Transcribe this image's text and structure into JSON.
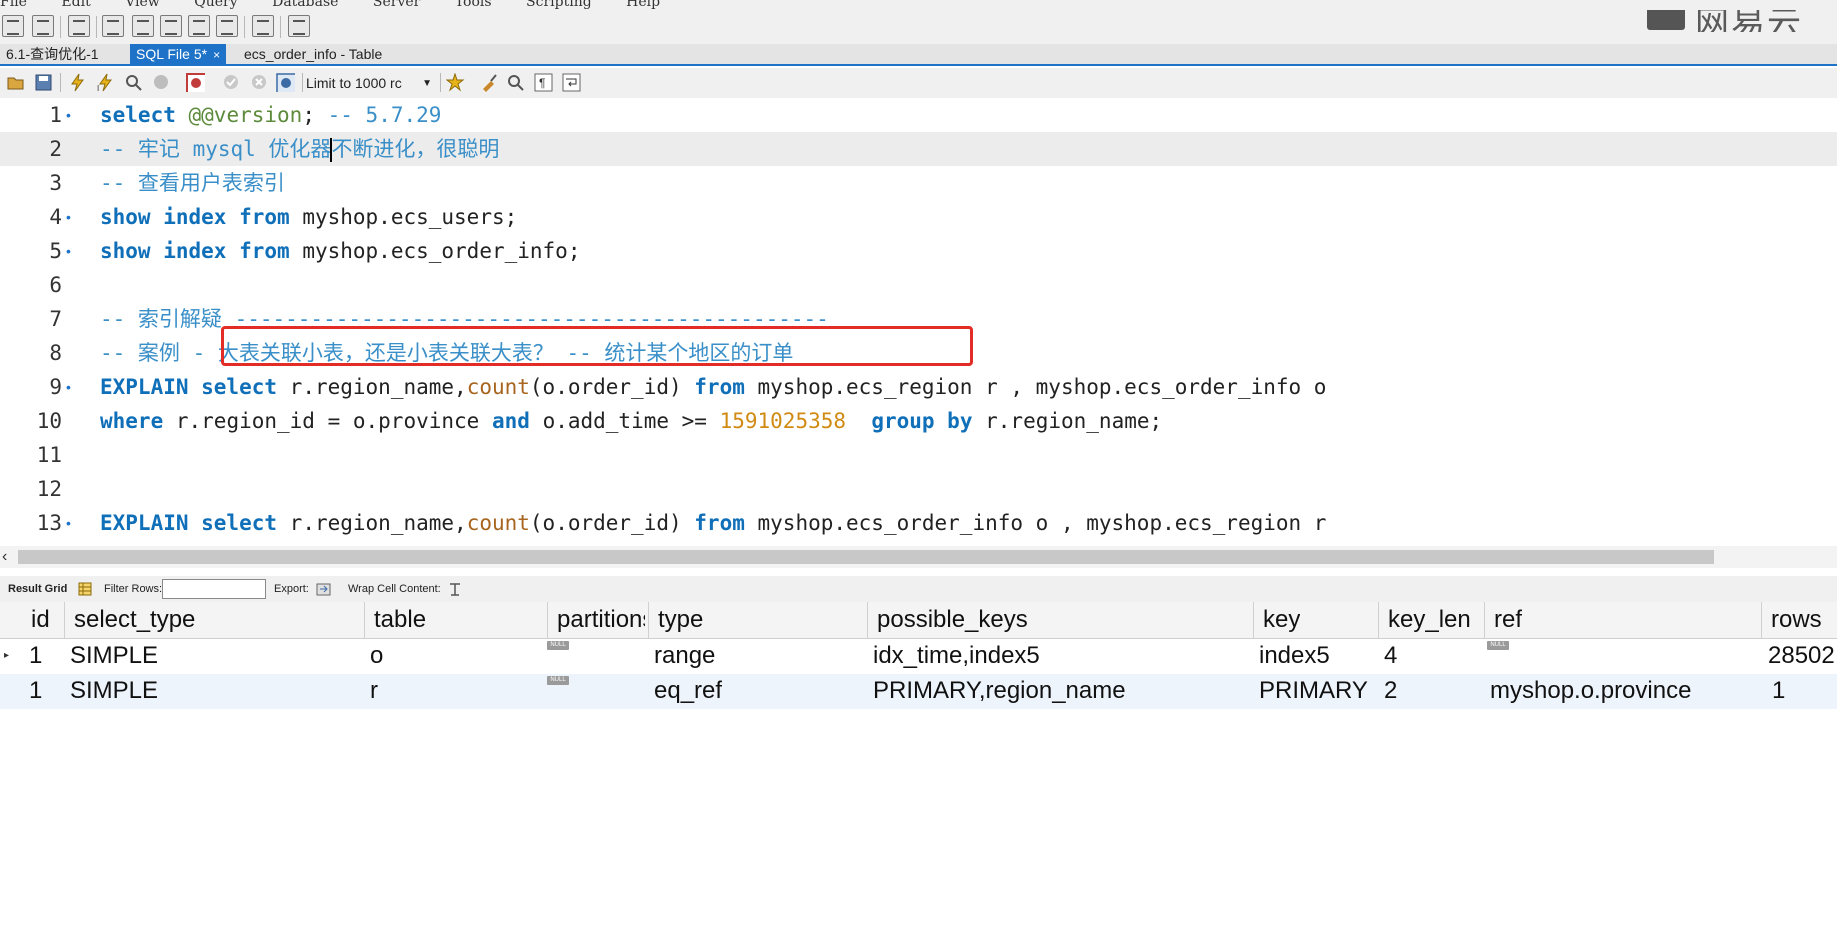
{
  "menu": [
    "File",
    "Edit",
    "View",
    "Query",
    "Database",
    "Server",
    "Tools",
    "Scripting",
    "Help"
  ],
  "logo_text": "网易云",
  "tabs": [
    {
      "label": "6.1-查询优化-1",
      "active": false
    },
    {
      "label": "SQL File 5*",
      "active": true,
      "close": "×"
    },
    {
      "label": "ecs_order_info - Table",
      "active": false
    }
  ],
  "toolbar2": {
    "limit_label": "Limit to 1000 rc"
  },
  "editor": {
    "lines": [
      {
        "n": "1",
        "marker": "•"
      },
      {
        "n": "2",
        "marker": ""
      },
      {
        "n": "3",
        "marker": ""
      },
      {
        "n": "4",
        "marker": "•"
      },
      {
        "n": "5",
        "marker": "•"
      },
      {
        "n": "6",
        "marker": ""
      },
      {
        "n": "7",
        "marker": ""
      },
      {
        "n": "8",
        "marker": ""
      },
      {
        "n": "9",
        "marker": "•"
      },
      {
        "n": "10",
        "marker": ""
      },
      {
        "n": "11",
        "marker": ""
      },
      {
        "n": "12",
        "marker": ""
      },
      {
        "n": "13",
        "marker": "•"
      }
    ],
    "l1": {
      "kw": "select",
      "var": "@@version",
      "rest": ";",
      "comment": "-- 5.7.29"
    },
    "l2": {
      "comment_a": "-- 牢记 mysql 优化器",
      "comment_b": "不断进化，很聪明"
    },
    "l3": {
      "comment": "-- 查看用户表索引"
    },
    "l4": {
      "kw": "show index from",
      "rest": "myshop.ecs_users;"
    },
    "l5": {
      "kw": "show index from",
      "rest": "myshop.ecs_order_info;"
    },
    "l7": {
      "comment": "-- 索引解疑 -----------------------------------------------"
    },
    "l8": {
      "comment": "-- 案例 - 大表关联小表，还是小表关联大表？ -- 统计某个地区的订单"
    },
    "l9": {
      "kw1": "EXPLAIN select",
      "t1": "r.region_name,",
      "fn": "count",
      "t2": "(o.order_id)",
      "kw2": "from",
      "t3": "myshop.ecs_region r , myshop.ecs_order_info o"
    },
    "l10": {
      "kw1": "where",
      "t1": "r.region_id = o.province",
      "kw2": "and",
      "t2": "o.add_time >=",
      "num": "1591025358",
      "kw3": "group by",
      "t3": "r.region_name;"
    },
    "l13": {
      "kw1": "EXPLAIN select",
      "t1": "r.region_name,",
      "fn": "count",
      "t2": "(o.order_id)",
      "kw2": "from",
      "t3": "myshop.ecs_order_info o , myshop.ecs_region r"
    }
  },
  "resultbar": {
    "result_grid": "Result Grid",
    "filter_rows": "Filter Rows:",
    "export": "Export:",
    "wrap": "Wrap Cell Content:"
  },
  "grid": {
    "columns": [
      "id",
      "select_type",
      "table",
      "partitions",
      "type",
      "possible_keys",
      "key",
      "key_len",
      "ref",
      "rows"
    ],
    "rows": [
      [
        "1",
        "SIMPLE",
        "o",
        "",
        "range",
        "idx_time,index5",
        "index5",
        "4",
        "",
        "28502"
      ],
      [
        "1",
        "SIMPLE",
        "r",
        "",
        "eq_ref",
        "PRIMARY,region_name",
        "PRIMARY",
        "2",
        "myshop.o.province",
        "1"
      ]
    ],
    "null_label": "NULL"
  }
}
